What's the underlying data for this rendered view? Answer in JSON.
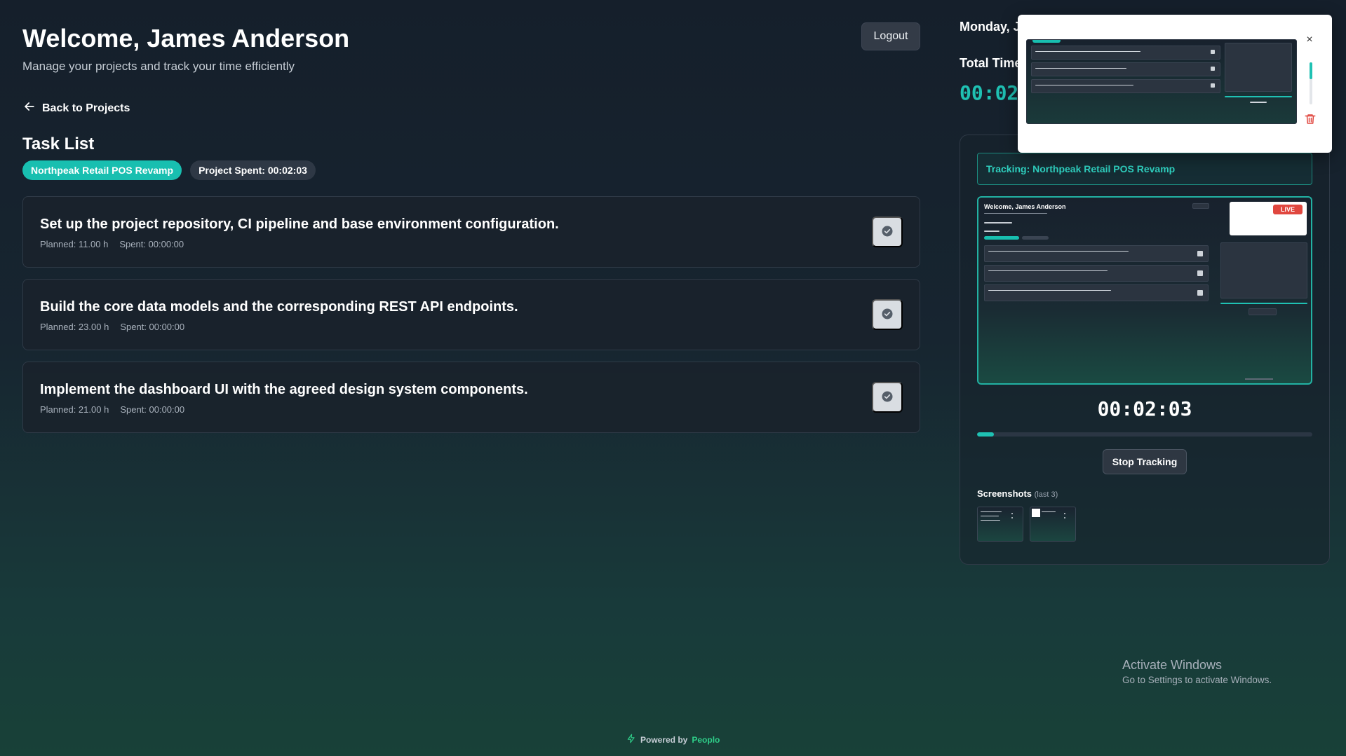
{
  "header": {
    "title": "Welcome, James Anderson",
    "subtitle": "Manage your projects and track your time efficiently",
    "logout_label": "Logout"
  },
  "nav": {
    "back_label": "Back to Projects"
  },
  "tasks_section": {
    "title": "Task List",
    "project_chip": "Northpeak Retail POS Revamp",
    "spent_chip": "Project Spent: 00:02:03",
    "tasks": [
      {
        "title": "Set up the project repository, CI pipeline and base environment configuration.",
        "planned": "Planned: 11.00 h",
        "spent": "Spent: 00:00:00"
      },
      {
        "title": "Build the core data models and the corresponding REST API endpoints.",
        "planned": "Planned: 23.00 h",
        "spent": "Spent: 00:00:00"
      },
      {
        "title": "Implement the dashboard UI with the agreed design system components.",
        "planned": "Planned: 21.00 h",
        "spent": "Spent: 00:00:00"
      }
    ]
  },
  "sidebar": {
    "date_label": "Monday, J",
    "total_time_label": "Total Time",
    "total_time_value": "00:02"
  },
  "tracker": {
    "tracking_label": "Tracking: Northpeak Retail POS Revamp",
    "preview": {
      "title": "Welcome, James Anderson",
      "live_badge": "LIVE"
    },
    "timer": "00:02:03",
    "progress_fraction": 0.05,
    "stop_label": "Stop Tracking",
    "screenshots_label": "Screenshots",
    "screenshots_note": "(last 3)"
  },
  "popup": {
    "close_glyph": "×"
  },
  "watermark": {
    "title": "Activate Windows",
    "subtitle": "Go to Settings to activate Windows."
  },
  "footer": {
    "powered_label": "Powered by",
    "brand": "Peoplo"
  },
  "icons": [
    "arrow-left-icon",
    "check-circle-icon",
    "close-icon",
    "trash-icon",
    "bolt-icon"
  ],
  "colors": {
    "accent": "#1fc1b3",
    "danger": "#e0473f",
    "brand_green": "#2fd08a"
  }
}
